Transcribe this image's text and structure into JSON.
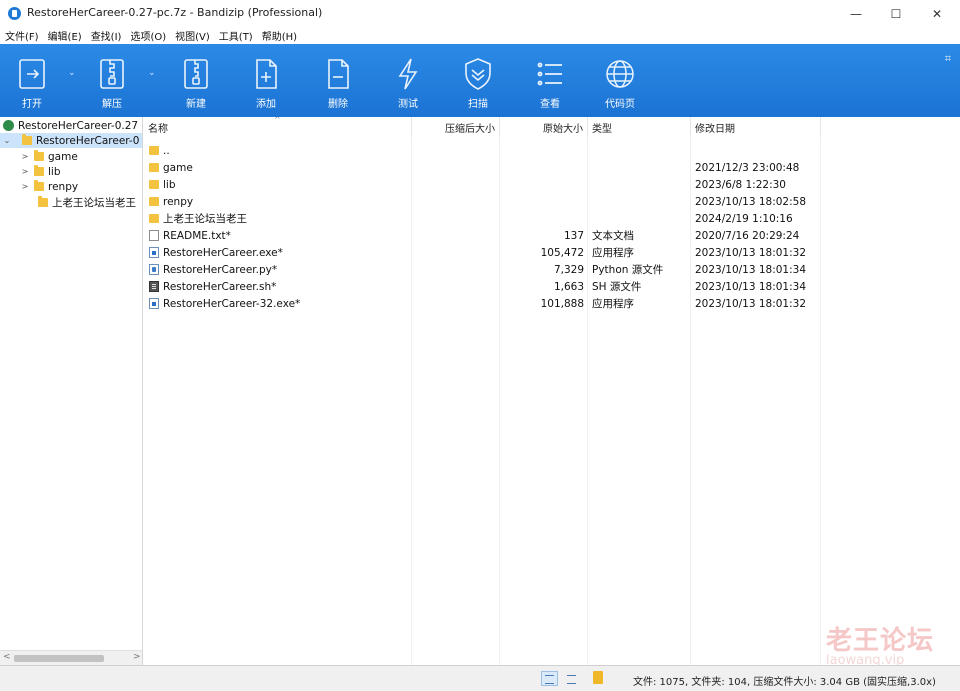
{
  "window": {
    "title": "RestoreHerCareer-0.27-pc.7z - Bandizip (Professional)",
    "controls": {
      "minimize": "—",
      "maximize": "☐",
      "close": "✕"
    }
  },
  "menu": [
    "文件(F)",
    "编辑(E)",
    "查找(I)",
    "选项(O)",
    "视图(V)",
    "工具(T)",
    "帮助(H)"
  ],
  "toolbar": {
    "buttons": [
      {
        "label": "打开",
        "icon": "open-icon"
      },
      {
        "label": "解压",
        "icon": "extract-icon"
      },
      {
        "label": "新建",
        "icon": "new-archive-icon"
      },
      {
        "label": "添加",
        "icon": "add-icon"
      },
      {
        "label": "删除",
        "icon": "delete-icon"
      },
      {
        "label": "测试",
        "icon": "test-icon"
      },
      {
        "label": "扫描",
        "icon": "scan-icon"
      },
      {
        "label": "查看",
        "icon": "view-icon"
      },
      {
        "label": "代码页",
        "icon": "codepage-icon"
      }
    ],
    "dropdown_arrow": "⌄",
    "corner_icon": "⌗"
  },
  "tree": {
    "root": "RestoreHerCareer-0.27",
    "items": [
      {
        "label": "RestoreHerCareer-0",
        "selected": true
      },
      {
        "label": "game"
      },
      {
        "label": "lib"
      },
      {
        "label": "renpy"
      },
      {
        "label": "上老王论坛当老王"
      }
    ],
    "arrow_collapsed": ">",
    "arrow_expanded": "⌄",
    "scroll_left": "<",
    "scroll_right": ">"
  },
  "list": {
    "columns": {
      "name": "名称",
      "packed": "压缩后大小",
      "size": "原始大小",
      "type": "类型",
      "modified": "修改日期"
    },
    "sort_arrow": "^",
    "rows": [
      {
        "icon": "folder",
        "name": "..",
        "packed": "",
        "size": "",
        "type": "",
        "modified": ""
      },
      {
        "icon": "folder",
        "name": "game",
        "packed": "",
        "size": "",
        "type": "",
        "modified": "2021/12/3 23:00:48"
      },
      {
        "icon": "folder",
        "name": "lib",
        "packed": "",
        "size": "",
        "type": "",
        "modified": "2023/6/8 1:22:30"
      },
      {
        "icon": "folder",
        "name": "renpy",
        "packed": "",
        "size": "",
        "type": "",
        "modified": "2023/10/13 18:02:58"
      },
      {
        "icon": "folder",
        "name": "上老王论坛当老王",
        "packed": "",
        "size": "",
        "type": "",
        "modified": "2024/2/19 1:10:16"
      },
      {
        "icon": "txt",
        "name": "README.txt*",
        "packed": "",
        "size": "137",
        "type": "文本文档",
        "modified": "2020/7/16 20:29:24"
      },
      {
        "icon": "exe",
        "name": "RestoreHerCareer.exe*",
        "packed": "",
        "size": "105,472",
        "type": "应用程序",
        "modified": "2023/10/13 18:01:32"
      },
      {
        "icon": "py",
        "name": "RestoreHerCareer.py*",
        "packed": "",
        "size": "7,329",
        "type": "Python 源文件",
        "modified": "2023/10/13 18:01:34"
      },
      {
        "icon": "sh",
        "name": "RestoreHerCareer.sh*",
        "packed": "",
        "size": "1,663",
        "type": "SH 源文件",
        "modified": "2023/10/13 18:01:34"
      },
      {
        "icon": "exe",
        "name": "RestoreHerCareer-32.exe*",
        "packed": "",
        "size": "101,888",
        "type": "应用程序",
        "modified": "2023/10/13 18:01:32"
      }
    ]
  },
  "watermark": {
    "text": "老王论坛",
    "sub": "laowang.vip"
  },
  "status": {
    "summary": "文件: 1075, 文件夹: 104, 压缩文件大小: 3.04 GB (固实压缩,3.0x)"
  },
  "colors": {
    "toolbar": "#1f7ad6",
    "selection": "#cce4fb",
    "folder": "#f3c23e"
  }
}
